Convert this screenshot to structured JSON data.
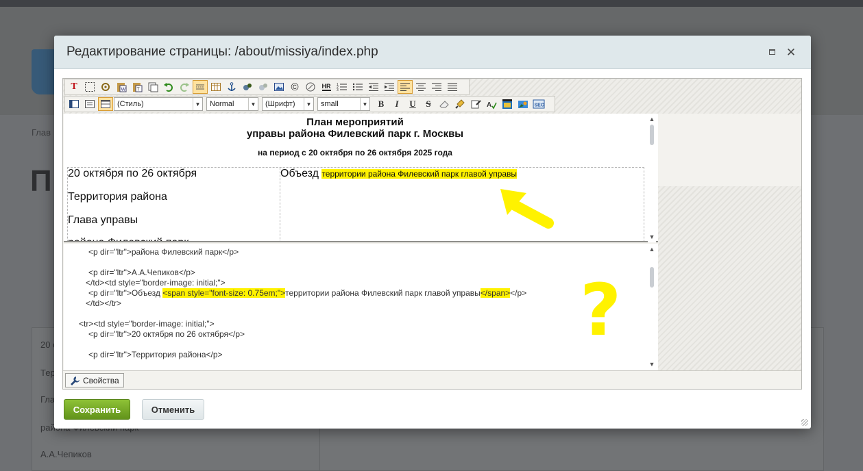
{
  "background": {
    "breadcrumb": "Глав",
    "page_title": "П",
    "table_cells": [
      "20 с",
      "Тер",
      "Гла",
      "района Филевский парк",
      "А.А.Чепиков"
    ]
  },
  "modal": {
    "title": "Редактирование страницы: /about/missiya/index.php",
    "controls": {
      "maximize_icon": "maximize-icon",
      "close_icon": "close-icon",
      "close_glyph": "✕"
    }
  },
  "toolbar": {
    "style_select": "(Стиль)",
    "format_select": "Normal",
    "font_select": "(Шрифт)",
    "size_select": "small",
    "bold": "B",
    "italic": "I",
    "underline": "U",
    "strike": "S"
  },
  "document": {
    "title_line1": "План мероприятий",
    "title_line2": "управы района Филевский парк г. Москвы",
    "subtitle": "на период с 20 октября по 26 октября 2025 года",
    "cell_left": [
      "20 октября по 26 октября",
      "Территория района",
      "Глава управы",
      "района Филевский парк"
    ],
    "cell_right_prefix": "Объезд",
    "cell_right_highlight": "территории района Филевский парк главой управы"
  },
  "source": {
    "lines": [
      "<p dir=\"ltr\">района Филевский парк</p>",
      "<p dir=\"ltr\">А.А.Чепиков</p>",
      "</td><td style=\"border-image: initial;\">",
      "</td></tr>",
      "<tr><td style=\"border-image: initial;\">",
      "<p dir=\"ltr\">20 октября по 26 октября</p>",
      "<p dir=\"ltr\">Территория района</p>"
    ],
    "objezd_prefix": "<p dir=\"ltr\">Объезд ",
    "span_open": "<span style=\"font-size: 0.75em;\">",
    "objezd_text": "территории района Филевский парк главой управы",
    "span_close": "</span>",
    "p_close": "</p>"
  },
  "statusbar": {
    "properties_label": "Свойства"
  },
  "footer": {
    "save_label": "Сохранить",
    "cancel_label": "Отменить"
  },
  "annotation": {
    "question_mark": "?"
  },
  "colors": {
    "highlight": "#fff200",
    "save_green": "#7ab02c",
    "modal_header": "#dfe8eb"
  }
}
